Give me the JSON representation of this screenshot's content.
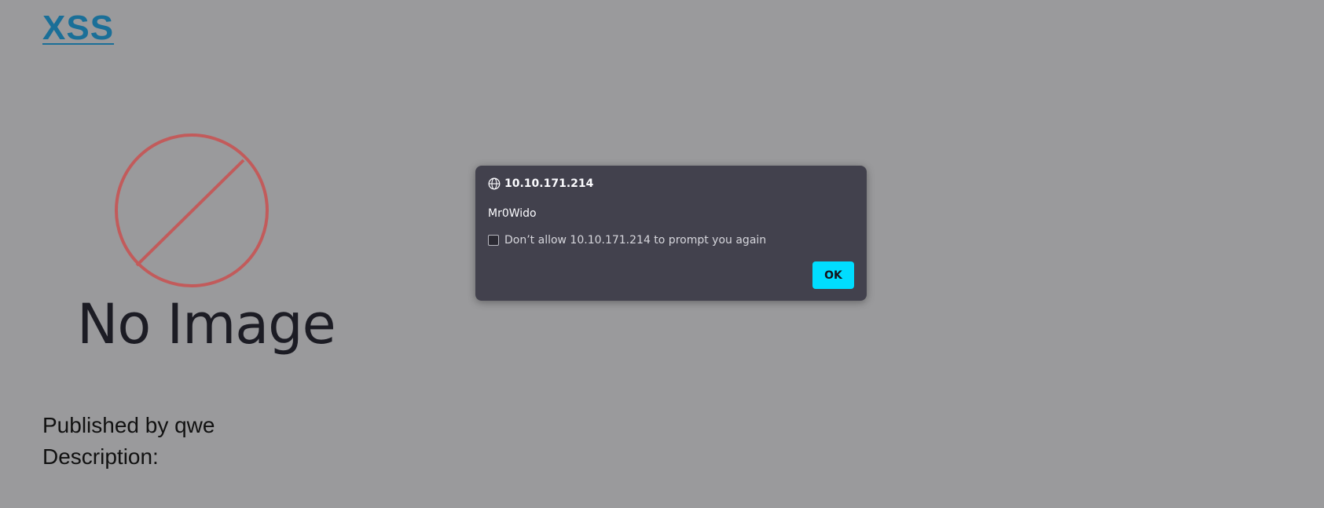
{
  "site": {
    "title": "XSS"
  },
  "post": {
    "image_placeholder_text": "No Image",
    "published_by": "Published by qwe",
    "description_label": "Description:"
  },
  "dialog": {
    "origin": "10.10.171.214",
    "message": "Mr0Wido",
    "checkbox_label": "Don’t allow 10.10.171.214 to prompt you again",
    "ok_label": "OK"
  },
  "colors": {
    "page_overlay": "#9a9a9c",
    "title_link": "#1a6f98",
    "dialog_bg": "#42414d",
    "ok_button": "#00ddff",
    "no_image_circle": "#c25b5b"
  }
}
